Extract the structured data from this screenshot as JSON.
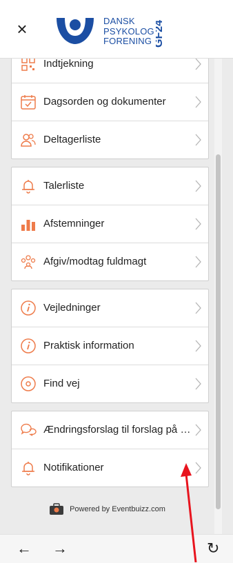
{
  "header": {
    "close_label": "×",
    "logo_lines": [
      "DANSK",
      "PSYKOLOG",
      "FORENING"
    ],
    "badge": "GF24",
    "brand_color": "#1b4ea3",
    "accent_color": "#ee7b4a"
  },
  "groups": [
    {
      "items": [
        {
          "label": "Indtjekning",
          "icon": "qr-icon"
        },
        {
          "label": "Dagsorden og dokumenter",
          "icon": "calendar-icon"
        },
        {
          "label": "Deltagerliste",
          "icon": "people-icon"
        }
      ]
    },
    {
      "items": [
        {
          "label": "Talerliste",
          "icon": "bell-icon"
        },
        {
          "label": "Afstemninger",
          "icon": "bar-chart-icon"
        },
        {
          "label": "Afgiv/modtag fuldmagt",
          "icon": "group-icon"
        }
      ]
    },
    {
      "items": [
        {
          "label": "Vejledninger",
          "icon": "info-icon"
        },
        {
          "label": "Praktisk information",
          "icon": "info-icon"
        },
        {
          "label": "Find vej",
          "icon": "location-pin-icon"
        }
      ]
    },
    {
      "items": [
        {
          "label": "Ændringsforslag til forslag på dagsorden",
          "icon": "chat-bubbles-icon"
        },
        {
          "label": "Notifikationer",
          "icon": "bell-icon"
        }
      ]
    }
  ],
  "footer": {
    "powered_by": "Powered by Eventbuizz.com"
  },
  "browser": {
    "back": "←",
    "forward": "→",
    "reload": "↻"
  },
  "annotation_color": "#e8141e"
}
